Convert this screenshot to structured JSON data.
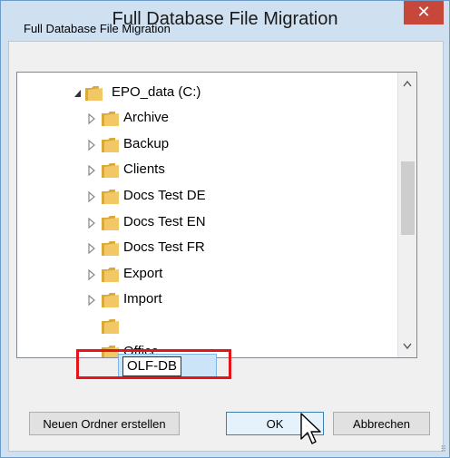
{
  "window": {
    "title": "Full Database File Migration",
    "close_glyph": "✕"
  },
  "description": "Full Database File Migration",
  "tree": {
    "root": {
      "label": "EPO_data (C:)",
      "expanded": true
    },
    "items": [
      {
        "label": "Archive"
      },
      {
        "label": "Backup"
      },
      {
        "label": "Clients"
      },
      {
        "label": "Docs Test DE"
      },
      {
        "label": "Docs Test EN"
      },
      {
        "label": "Docs Test FR"
      },
      {
        "label": "Export"
      },
      {
        "label": "Import"
      }
    ],
    "editing_item": {
      "value": "OLF-DB"
    },
    "partial_item": {
      "label": "Office"
    }
  },
  "buttons": {
    "new_folder": "Neuen Ordner erstellen",
    "ok": "OK",
    "cancel": "Abbrechen"
  },
  "colors": {
    "highlight": "#e4141b",
    "folder": "#e8b84a",
    "close": "#c7473a"
  }
}
